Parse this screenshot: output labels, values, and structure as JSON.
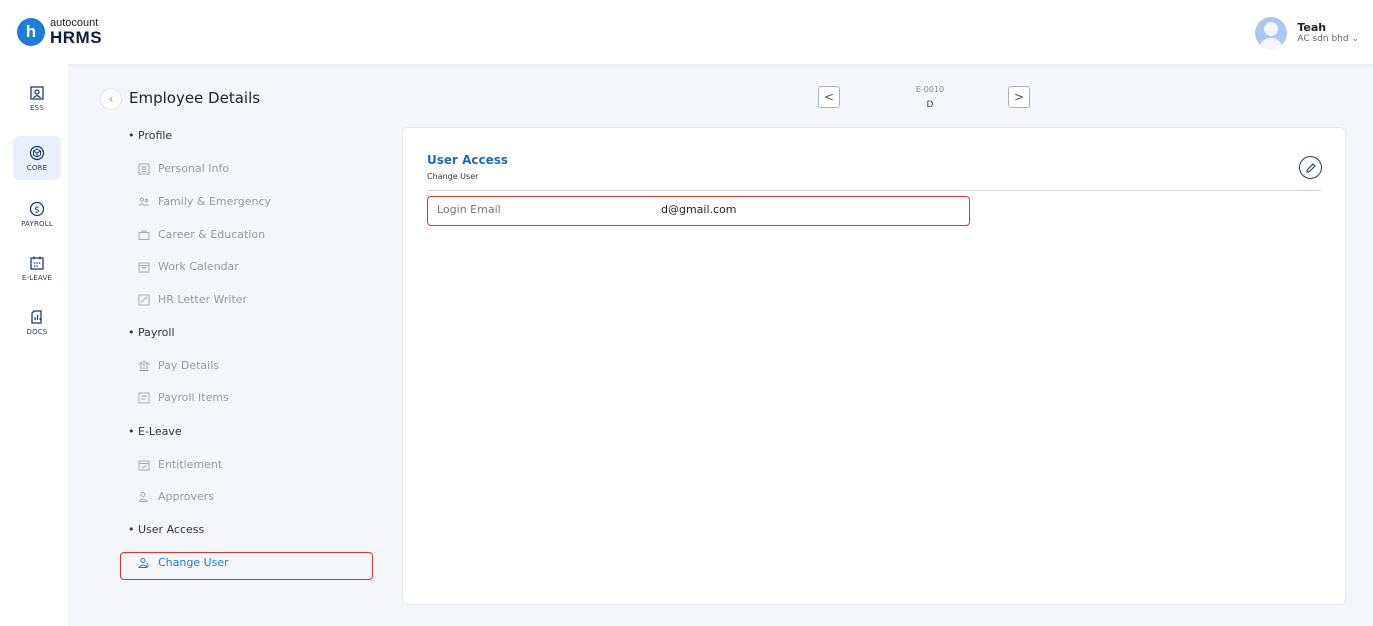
{
  "brand": {
    "logo_letter": "h",
    "auto_text": "autocount",
    "product": "HRMS"
  },
  "user": {
    "name": "Teah",
    "company": "AC sdn bhd"
  },
  "rail": [
    {
      "label": "ESS",
      "icon": "ess-icon"
    },
    {
      "label": "CORE",
      "icon": "core-icon",
      "active": true
    },
    {
      "label": "PAYROLL",
      "icon": "payroll-icon"
    },
    {
      "label": "E-LEAVE",
      "icon": "eleave-icon"
    },
    {
      "label": "DOCS",
      "icon": "docs-icon"
    }
  ],
  "header": {
    "title": "Employee Details",
    "employee_code": "E-0010",
    "employee_name": "D"
  },
  "subnav": {
    "profile": {
      "label": "Profile",
      "items": [
        "Personal Info",
        "Family & Emergency",
        "Career & Education",
        "Work Calendar",
        "HR Letter Writer"
      ]
    },
    "payroll": {
      "label": "Payroll",
      "items": [
        "Pay Details",
        "Payroll Items"
      ]
    },
    "eleave": {
      "label": "E-Leave",
      "items": [
        "Entitlement",
        "Approvers"
      ]
    },
    "user_access": {
      "label": "User Access",
      "items": [
        "Change User"
      ]
    }
  },
  "card": {
    "title": "User Access",
    "subtitle": "Change User",
    "field_label": "Login Email",
    "field_value": "d@gmail.com"
  },
  "colors": {
    "accent": "#1c7ed6",
    "highlight": "#e03131"
  }
}
